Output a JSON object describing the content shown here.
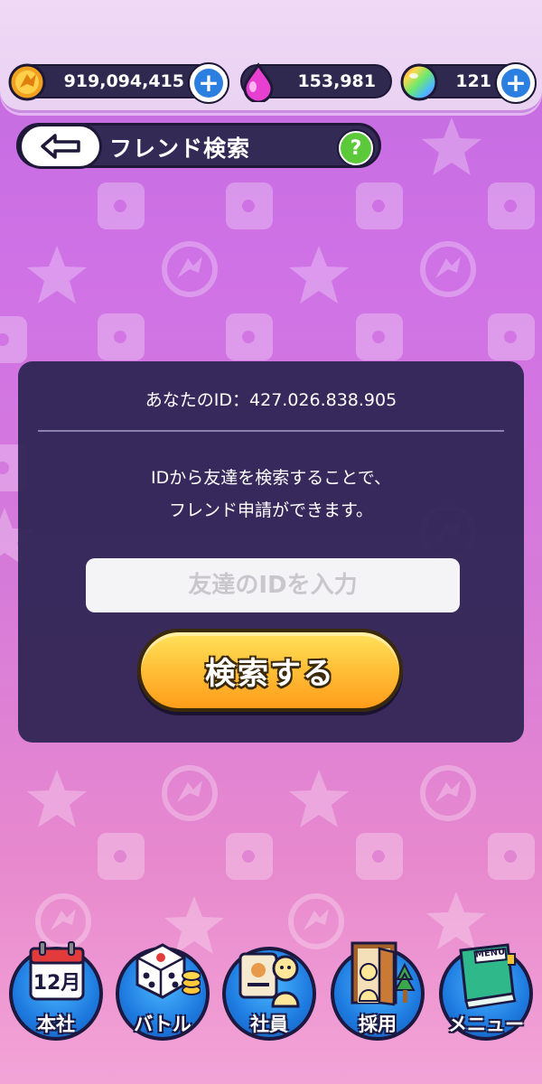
{
  "status": {
    "coins": "919,094,415",
    "gems": "153,981",
    "orbs": "121"
  },
  "header": {
    "title": "フレンド検索"
  },
  "panel": {
    "your_id_label": "あなたのID：427.026.838.905",
    "description_line1": "IDから友達を検索することで、",
    "description_line2": "フレンド申請ができます。",
    "input_placeholder": "友達のIDを入力",
    "search_button": "検索する"
  },
  "nav": {
    "items": [
      {
        "label": "本社",
        "calendar": "12月"
      },
      {
        "label": "バトル"
      },
      {
        "label": "社員"
      },
      {
        "label": "採用"
      },
      {
        "label": "メニュー",
        "book": "MENU"
      }
    ]
  },
  "colors": {
    "accent": "#ffc23a",
    "panel": "#2c2452",
    "nav": "#1e7be0"
  }
}
